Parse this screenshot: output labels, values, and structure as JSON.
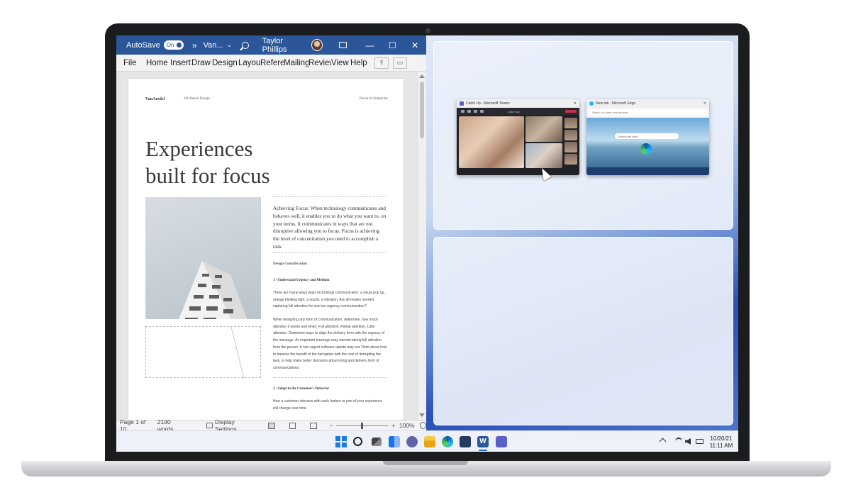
{
  "word": {
    "titlebar": {
      "autosave_label": "AutoSave",
      "autosave_state": "On",
      "more_glyph": "»",
      "doc_name": "Van...",
      "doc_dropdown_glyph": "⌄",
      "user_name": "Taylor Phillips",
      "minimize_glyph": "—",
      "maximize_glyph": "☐",
      "close_glyph": "✕"
    },
    "menu": {
      "file": "File",
      "home": "Home",
      "insert": "Insert",
      "draw": "Draw",
      "design": "Design",
      "layout": "Layout",
      "references": "References",
      "mailings": "Mailings",
      "review": "Review",
      "view": "View",
      "help": "Help"
    },
    "document": {
      "header_brand": "VanArsdel",
      "header_mid": "VA Shared Design",
      "header_right": "Power & Simplicity",
      "headline_line1": "Experiences",
      "headline_line2": "built for focus",
      "intro": "Achieving Focus: When technology communicates and behaves well, it enables you to do what you want to, on your terms. It communicates in ways that are not disruptive allowing you to focus. Focus is achieving the level of concentration you need to accomplish a task.",
      "section_title": "Design Consideration",
      "sub1": "1 / Understand Urgency and Medium",
      "para1": "There are many ways ways technology communicates: a visual pop up, orange blinking light, a sound, a vibration. Are all modes needed, capturing full attention for one low urgency communication?",
      "para2": "When designing any form of communication, determine, how much attention it needs and when: Full attention, Partial attention, Little attention. Determine ways to align the delivery form with the urgency of the message. As important message may warrant taking full attention from the person. A non-urgent software update may not.Think about how to balance the benefit of the iterruption with the cost of iterrupting the task, to help make better decisions about iming and delivery form of communications.",
      "sub2": "2 / Adapt to the Customer's Behavior",
      "para3": "How a customer interacts with each feature or part of your experience will change over time."
    },
    "status": {
      "page": "Page 1 of 10",
      "words": "2190 words",
      "display_settings": "Display Settings",
      "zoom_minus": "−",
      "zoom_plus": "+",
      "zoom": "100%",
      "zoom_fraction": 0.5
    }
  },
  "snap": {
    "teams_title": "Catch Up - Microsoft Teams",
    "teams_meeting_label": "Catch Up",
    "edge_title": "New tab - Microsoft Edge",
    "edge_address": "Search or enter web address",
    "edge_search_placeholder": "Search the web"
  },
  "taskbar": {
    "date": "10/20/21",
    "time": "11:11 AM"
  }
}
